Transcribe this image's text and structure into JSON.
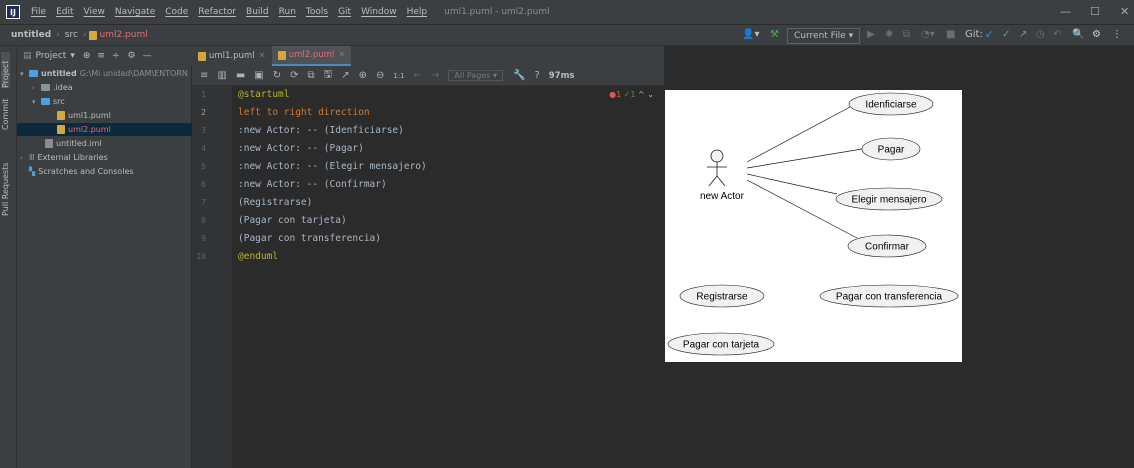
{
  "menubar": {
    "items": [
      "File",
      "Edit",
      "View",
      "Navigate",
      "Code",
      "Refactor",
      "Build",
      "Run",
      "Tools",
      "Git",
      "Window",
      "Help"
    ],
    "window_title": "uml1.puml - uml2.puml"
  },
  "navbar": {
    "project": "untitled",
    "folder": "src",
    "file": "uml2.puml",
    "run_config": "Current File ▾",
    "git_label": "Git:"
  },
  "toolstripe": {
    "project": "Project",
    "commit": "Commit",
    "pull_requests": "Pull Requests"
  },
  "project_panel": {
    "header": "Project",
    "tree": [
      {
        "label": "untitled",
        "path": "G:\\Mi unidad\\DAM\\ENTORN"
      },
      {
        "label": ".idea"
      },
      {
        "label": "src"
      },
      {
        "label": "uml1.puml"
      },
      {
        "label": "uml2.puml"
      },
      {
        "label": "untitled.iml"
      },
      {
        "label": "External Libraries"
      },
      {
        "label": "Scratches and Consoles"
      }
    ]
  },
  "tabs": [
    {
      "label": "uml1.puml",
      "active": false
    },
    {
      "label": "uml2.puml",
      "active": true
    }
  ],
  "editor_toolbar": {
    "all_pages": "All Pages ▾",
    "help": "?",
    "timing": "97ms",
    "zoom": "1:1"
  },
  "inspections": {
    "errors": "1",
    "warnings": "1"
  },
  "editor": {
    "line_numbers": [
      "1",
      "2",
      "3",
      "4",
      "5",
      "6",
      "7",
      "8",
      "9",
      "10"
    ],
    "lines": [
      "@startuml",
      "left to right direction",
      ":new Actor: -- (Idenficiarse)",
      ":new Actor: -- (Pagar)",
      ":new Actor: -- (Elegir mensajero)",
      ":new Actor: -- (Confirmar)",
      "(Registrarse)",
      "(Pagar con tarjeta)",
      "(Pagar con transferencia)",
      "@enduml"
    ]
  },
  "diagram": {
    "actor": "new Actor",
    "usecases": [
      "Idenficiarse",
      "Pagar",
      "Elegir mensajero",
      "Confirmar",
      "Registrarse",
      "Pagar con transferencia",
      "Pagar con tarjeta"
    ]
  }
}
